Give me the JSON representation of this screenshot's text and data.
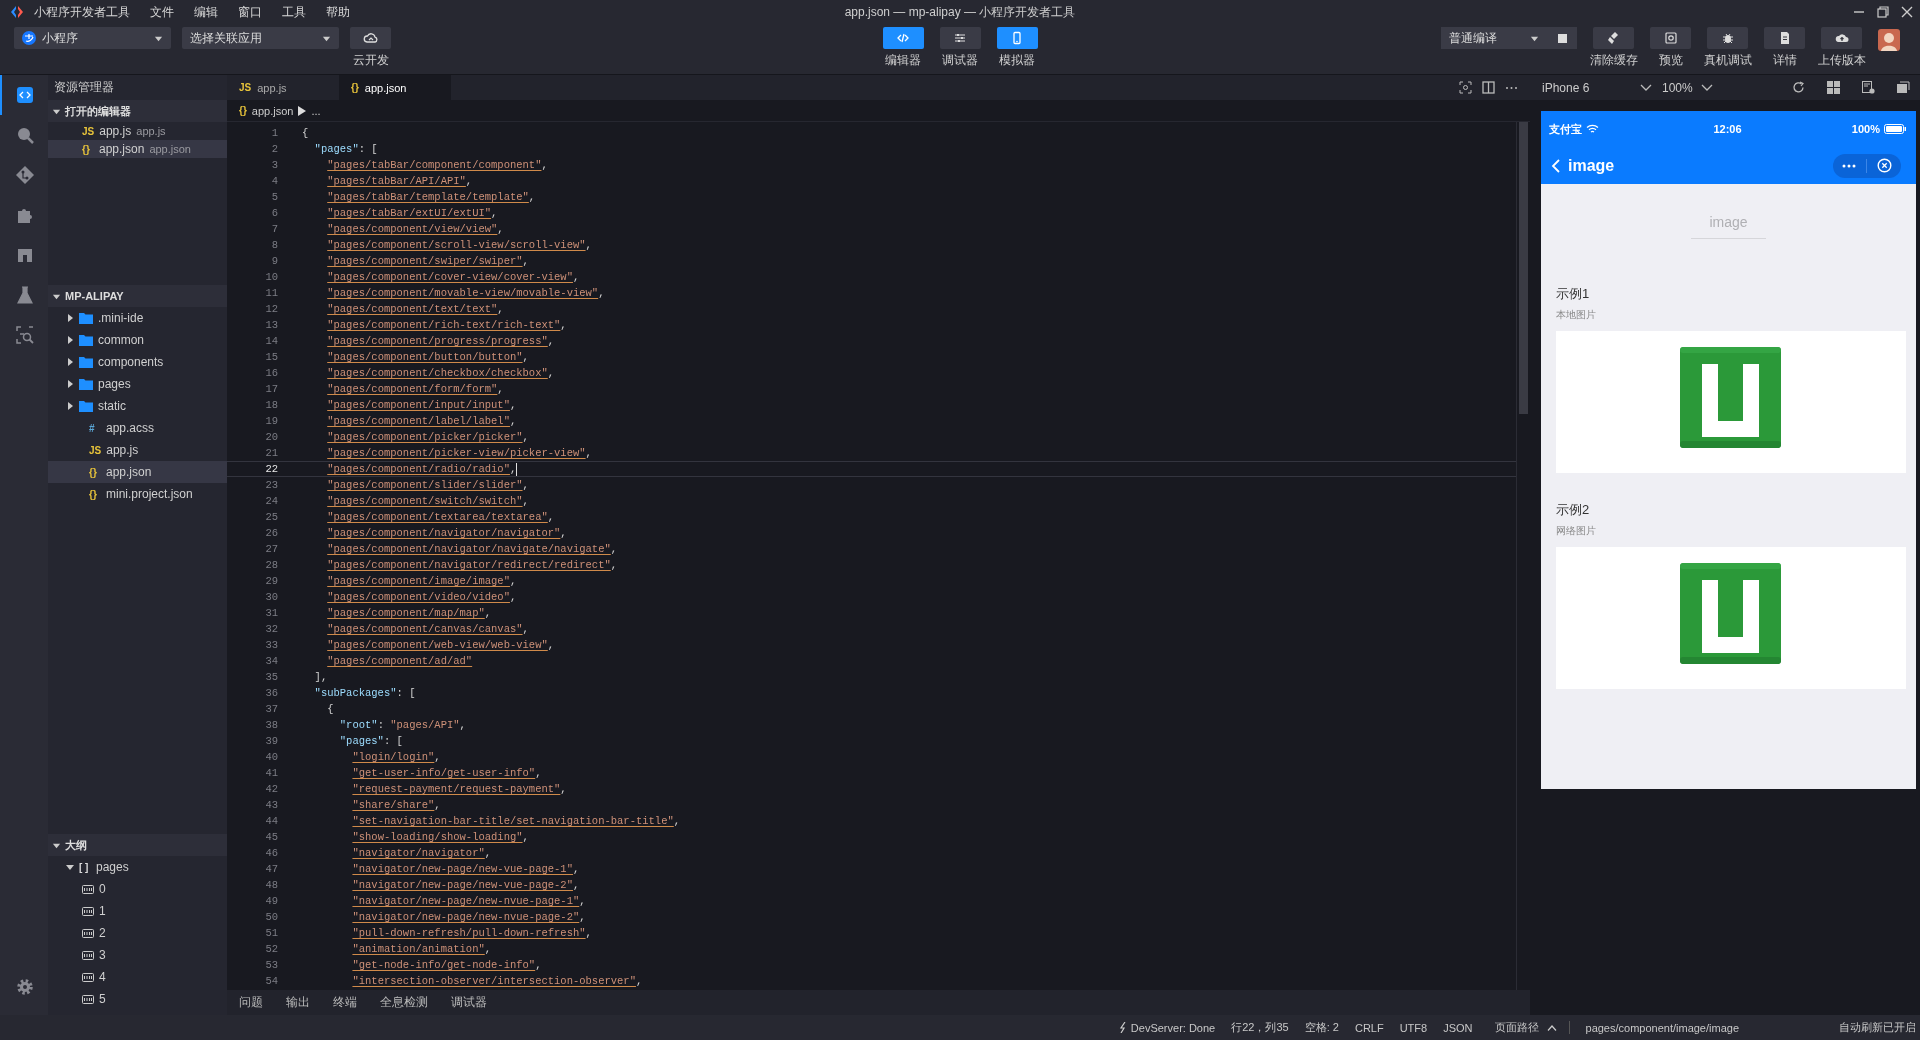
{
  "menubar": {
    "menus": [
      "小程序开发者工具",
      "文件",
      "编辑",
      "窗口",
      "工具",
      "帮助"
    ],
    "title": "app.json — mp-alipay — 小程序开发者工具"
  },
  "toolbar": {
    "app_type": "小程序",
    "linked_app": "选择关联应用",
    "cloud_label": "云开发",
    "modes": [
      {
        "kind": "code",
        "label": "编辑器",
        "on": true
      },
      {
        "kind": "debug",
        "label": "调试器",
        "on": false
      },
      {
        "kind": "phone",
        "label": "模拟器",
        "on": true
      }
    ],
    "compile_mode": "普通编译",
    "actions": [
      {
        "kind": "clean",
        "label": "清除缓存"
      },
      {
        "kind": "preview",
        "label": "预览"
      },
      {
        "kind": "device",
        "label": "真机调试"
      },
      {
        "kind": "details",
        "label": "详情"
      },
      {
        "kind": "upload",
        "label": "上传版本"
      }
    ]
  },
  "activity_bar": {
    "items": [
      {
        "kind": "explorer",
        "selected": true
      },
      {
        "kind": "search",
        "selected": false
      },
      {
        "kind": "git",
        "selected": false
      },
      {
        "kind": "extensions",
        "selected": false
      },
      {
        "kind": "layout",
        "selected": false
      },
      {
        "kind": "test",
        "selected": false
      },
      {
        "kind": "inspect",
        "selected": false
      }
    ],
    "bottom_items": [
      {
        "kind": "settings",
        "selected": false
      }
    ]
  },
  "sidebar": {
    "title": "资源管理器",
    "open_editors": {
      "title": "打开的编辑器",
      "expanded": true,
      "items": [
        {
          "badge": "JS",
          "name": "app.js",
          "path": "app.js",
          "selected": false
        },
        {
          "badge": "{}",
          "name": "app.json",
          "path": "app.json",
          "selected": true
        }
      ]
    },
    "project": {
      "title": "MP-ALIPAY",
      "expanded": true,
      "items": [
        {
          "kind": "folder",
          "name": ".mini-ide",
          "expanded": false,
          "selected": false
        },
        {
          "kind": "folder",
          "name": "common",
          "expanded": false,
          "selected": false
        },
        {
          "kind": "folder",
          "name": "components",
          "expanded": false,
          "selected": false
        },
        {
          "kind": "folder",
          "name": "pages",
          "expanded": false,
          "selected": false
        },
        {
          "kind": "folder",
          "name": "static",
          "expanded": false,
          "selected": false
        },
        {
          "kind": "file",
          "badge": "#",
          "name": "app.acss",
          "selected": false
        },
        {
          "kind": "file",
          "badge": "JS",
          "name": "app.js",
          "selected": false
        },
        {
          "kind": "file",
          "badge": "{}",
          "name": "app.json",
          "selected": true
        },
        {
          "kind": "file",
          "badge": "{}",
          "name": "mini.project.json",
          "selected": false
        }
      ]
    },
    "outline": {
      "title": "大纲",
      "expanded": true,
      "items": [
        {
          "badge": "[ ]",
          "name": "pages",
          "expanded": true,
          "children": [
            {
              "name": "0"
            },
            {
              "name": "1"
            },
            {
              "name": "2"
            },
            {
              "name": "3"
            },
            {
              "name": "4"
            },
            {
              "name": "5"
            }
          ]
        }
      ]
    }
  },
  "editor": {
    "tabs": [
      {
        "badge": "JS",
        "label": "app.js",
        "selected": false
      },
      {
        "badge": "{}",
        "label": "app.json",
        "selected": true
      }
    ],
    "breadcrumb": {
      "badge": "{}",
      "file": "app.json",
      "more": "..."
    },
    "lines": [
      {
        "number": "1",
        "text": "{",
        "current": false,
        "warning": false
      },
      {
        "number": "2",
        "text": "  \"pages\": [",
        "current": false,
        "warning": false
      },
      {
        "number": "3",
        "text": "    \"pages/tabBar/component/component\",",
        "current": false,
        "warning": true
      },
      {
        "number": "4",
        "text": "    \"pages/tabBar/API/API\",",
        "current": false,
        "warning": true
      },
      {
        "number": "5",
        "text": "    \"pages/tabBar/template/template\",",
        "current": false,
        "warning": true
      },
      {
        "number": "6",
        "text": "    \"pages/tabBar/extUI/extUI\",",
        "current": false,
        "warning": true
      },
      {
        "number": "7",
        "text": "    \"pages/component/view/view\",",
        "current": false,
        "warning": true
      },
      {
        "number": "8",
        "text": "    \"pages/component/scroll-view/scroll-view\",",
        "current": false,
        "warning": true
      },
      {
        "number": "9",
        "text": "    \"pages/component/swiper/swiper\",",
        "current": false,
        "warning": true
      },
      {
        "number": "10",
        "text": "    \"pages/component/cover-view/cover-view\",",
        "current": false,
        "warning": true
      },
      {
        "number": "11",
        "text": "    \"pages/component/movable-view/movable-view\",",
        "current": false,
        "warning": true
      },
      {
        "number": "12",
        "text": "    \"pages/component/text/text\",",
        "current": false,
        "warning": true
      },
      {
        "number": "13",
        "text": "    \"pages/component/rich-text/rich-text\",",
        "current": false,
        "warning": true
      },
      {
        "number": "14",
        "text": "    \"pages/component/progress/progress\",",
        "current": false,
        "warning": true
      },
      {
        "number": "15",
        "text": "    \"pages/component/button/button\",",
        "current": false,
        "warning": true
      },
      {
        "number": "16",
        "text": "    \"pages/component/checkbox/checkbox\",",
        "current": false,
        "warning": true
      },
      {
        "number": "17",
        "text": "    \"pages/component/form/form\",",
        "current": false,
        "warning": true
      },
      {
        "number": "18",
        "text": "    \"pages/component/input/input\",",
        "current": false,
        "warning": true
      },
      {
        "number": "19",
        "text": "    \"pages/component/label/label\",",
        "current": false,
        "warning": true
      },
      {
        "number": "20",
        "text": "    \"pages/component/picker/picker\",",
        "current": false,
        "warning": true
      },
      {
        "number": "21",
        "text": "    \"pages/component/picker-view/picker-view\",",
        "current": false,
        "warning": true
      },
      {
        "number": "22",
        "text": "    \"pages/component/radio/radio\",",
        "current": true,
        "warning": true
      },
      {
        "number": "23",
        "text": "    \"pages/component/slider/slider\",",
        "current": false,
        "warning": true
      },
      {
        "number": "24",
        "text": "    \"pages/component/switch/switch\",",
        "current": false,
        "warning": true
      },
      {
        "number": "25",
        "text": "    \"pages/component/textarea/textarea\",",
        "current": false,
        "warning": true
      },
      {
        "number": "26",
        "text": "    \"pages/component/navigator/navigator\",",
        "current": false,
        "warning": true
      },
      {
        "number": "27",
        "text": "    \"pages/component/navigator/navigate/navigate\",",
        "current": false,
        "warning": true
      },
      {
        "number": "28",
        "text": "    \"pages/component/navigator/redirect/redirect\",",
        "current": false,
        "warning": true
      },
      {
        "number": "29",
        "text": "    \"pages/component/image/image\",",
        "current": false,
        "warning": true
      },
      {
        "number": "30",
        "text": "    \"pages/component/video/video\",",
        "current": false,
        "warning": true
      },
      {
        "number": "31",
        "text": "    \"pages/component/map/map\",",
        "current": false,
        "warning": true
      },
      {
        "number": "32",
        "text": "    \"pages/component/canvas/canvas\",",
        "current": false,
        "warning": true
      },
      {
        "number": "33",
        "text": "    \"pages/component/web-view/web-view\",",
        "current": false,
        "warning": true
      },
      {
        "number": "34",
        "text": "    \"pages/component/ad/ad\"",
        "current": false,
        "warning": true
      },
      {
        "number": "35",
        "text": "  ],",
        "current": false,
        "warning": false
      },
      {
        "number": "36",
        "text": "  \"subPackages\": [",
        "current": false,
        "warning": false
      },
      {
        "number": "37",
        "text": "    {",
        "current": false,
        "warning": false
      },
      {
        "number": "38",
        "text": "      \"root\": \"pages/API\",",
        "current": false,
        "warning": false
      },
      {
        "number": "39",
        "text": "      \"pages\": [",
        "current": false,
        "warning": false
      },
      {
        "number": "40",
        "text": "        \"login/login\",",
        "current": false,
        "warning": true
      },
      {
        "number": "41",
        "text": "        \"get-user-info/get-user-info\",",
        "current": false,
        "warning": true
      },
      {
        "number": "42",
        "text": "        \"request-payment/request-payment\",",
        "current": false,
        "warning": true
      },
      {
        "number": "43",
        "text": "        \"share/share\",",
        "current": false,
        "warning": true
      },
      {
        "number": "44",
        "text": "        \"set-navigation-bar-title/set-navigation-bar-title\",",
        "current": false,
        "warning": true
      },
      {
        "number": "45",
        "text": "        \"show-loading/show-loading\",",
        "current": false,
        "warning": true
      },
      {
        "number": "46",
        "text": "        \"navigator/navigator\",",
        "current": false,
        "warning": true
      },
      {
        "number": "47",
        "text": "        \"navigator/new-page/new-vue-page-1\",",
        "current": false,
        "warning": true
      },
      {
        "number": "48",
        "text": "        \"navigator/new-page/new-vue-page-2\",",
        "current": false,
        "warning": true
      },
      {
        "number": "49",
        "text": "        \"navigator/new-page/new-nvue-page-1\",",
        "current": false,
        "warning": true
      },
      {
        "number": "50",
        "text": "        \"navigator/new-page/new-nvue-page-2\",",
        "current": false,
        "warning": true
      },
      {
        "number": "51",
        "text": "        \"pull-down-refresh/pull-down-refresh\",",
        "current": false,
        "warning": true
      },
      {
        "number": "52",
        "text": "        \"animation/animation\",",
        "current": false,
        "warning": true
      },
      {
        "number": "53",
        "text": "        \"get-node-info/get-node-info\",",
        "current": false,
        "warning": true
      },
      {
        "number": "54",
        "text": "        \"intersection-observer/intersection-observer\",",
        "current": false,
        "warning": true
      }
    ],
    "panel_tabs": [
      "问题",
      "输出",
      "终端",
      "全息检测",
      "调试器"
    ]
  },
  "simulator": {
    "device": "iPhone 6",
    "zoom": "100%",
    "phone": {
      "carrier": "支付宝",
      "time": "12:06",
      "battery": "100%",
      "nav_title": "image",
      "page_heading": "image",
      "sections": [
        {
          "title": "示例1",
          "subtitle": "本地图片"
        },
        {
          "title": "示例2",
          "subtitle": "网络图片"
        }
      ]
    }
  },
  "status_bar": {
    "server": "DevServer: Done",
    "position": "行22，列35",
    "indent": "空格: 2",
    "eol": "CRLF",
    "encoding": "UTF8",
    "language": "JSON",
    "page_path_label": "页面路径",
    "page_path": "pages/component/image/image",
    "auto_refresh": "自动刷新已开启"
  }
}
